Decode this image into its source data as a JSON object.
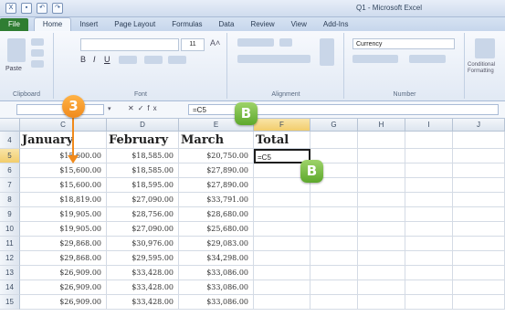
{
  "window": {
    "title": "Q1 - Microsoft Excel"
  },
  "ribbon_tabs": [
    "File",
    "Home",
    "Insert",
    "Page Layout",
    "Formulas",
    "Data",
    "Review",
    "View",
    "Add-Ins"
  ],
  "ribbon_groups": [
    "Clipboard",
    "Font",
    "Alignment",
    "Number"
  ],
  "ribbon_controls": {
    "paste_label": "Paste",
    "font_size": "11",
    "number_format": "Currency",
    "conditional_label": "Conditional Formatting"
  },
  "formula_bar": {
    "fx_symbol": "fx",
    "value": "=C5"
  },
  "columns": [
    "C",
    "D",
    "E",
    "F",
    "G",
    "H",
    "I",
    "J"
  ],
  "selected_column": "F",
  "header_row": {
    "row": "4",
    "C": "January",
    "D": "February",
    "E": "March",
    "F": "Total"
  },
  "rows": [
    {
      "n": "5",
      "C": "$15,600.00",
      "D": "$18,585.00",
      "E": "$20,750.00",
      "F": "=C5"
    },
    {
      "n": "6",
      "C": "$15,600.00",
      "D": "$18,585.00",
      "E": "$27,890.00",
      "F": ""
    },
    {
      "n": "7",
      "C": "$15,600.00",
      "D": "$18,595.00",
      "E": "$27,890.00",
      "F": ""
    },
    {
      "n": "8",
      "C": "$18,819.00",
      "D": "$27,090.00",
      "E": "$33,791.00",
      "F": ""
    },
    {
      "n": "9",
      "C": "$19,905.00",
      "D": "$28,756.00",
      "E": "$28,680.00",
      "F": ""
    },
    {
      "n": "10",
      "C": "$19,905.00",
      "D": "$27,090.00",
      "E": "$25,680.00",
      "F": ""
    },
    {
      "n": "11",
      "C": "$29,868.00",
      "D": "$30,976.00",
      "E": "$29,083.00",
      "F": ""
    },
    {
      "n": "12",
      "C": "$29,868.00",
      "D": "$29,595.00",
      "E": "$34,298.00",
      "F": ""
    },
    {
      "n": "13",
      "C": "$26,909.00",
      "D": "$33,428.00",
      "E": "$33,086.00",
      "F": ""
    },
    {
      "n": "14",
      "C": "$26,909.00",
      "D": "$33,428.00",
      "E": "$33,086.00",
      "F": ""
    },
    {
      "n": "15",
      "C": "$26,909.00",
      "D": "$33,428.00",
      "E": "$33,086.00",
      "F": ""
    }
  ],
  "callouts": {
    "step3": "3",
    "stepB_formula": "B",
    "stepB_cell": "B"
  },
  "colors": {
    "file_tab": "#2f7d32",
    "callout_orange": "#f08a1c",
    "callout_green": "#5da82c",
    "selected_header": "#f2cd6c"
  }
}
